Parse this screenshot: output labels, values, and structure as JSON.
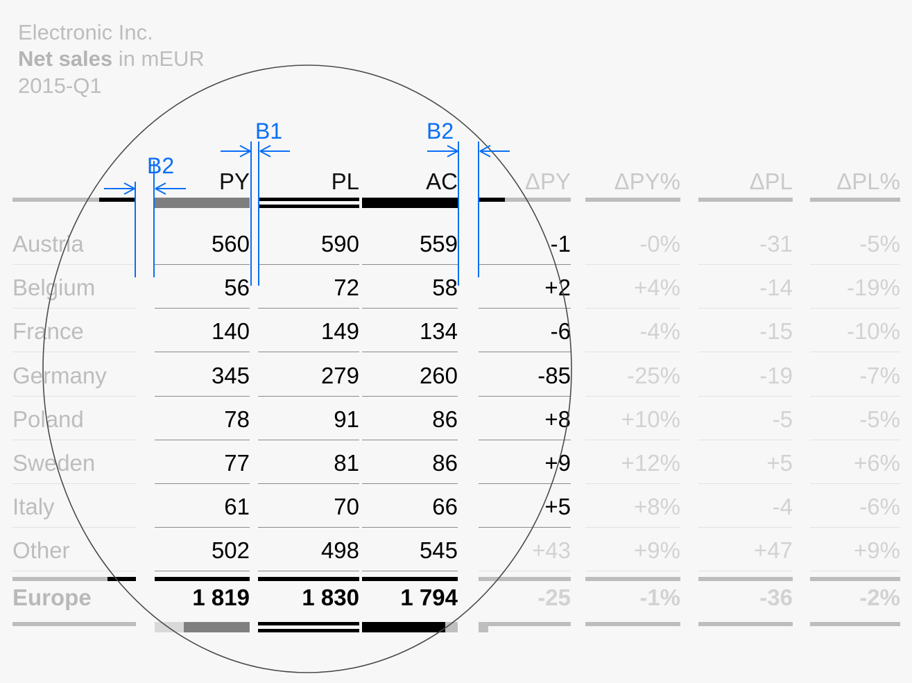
{
  "title": {
    "company": "Electronic Inc.",
    "measure_strong": "Net sales",
    "measure_rest": " in mEUR",
    "period": "2015-Q1"
  },
  "colors": {
    "annotation": "#0a6ef5",
    "previous_year": "#7f7f7f",
    "actual": "#000000",
    "plan": "#000000",
    "dim_text": "#c9c9c9"
  },
  "annotations": [
    {
      "label": "B2",
      "kind": "gap-wide"
    },
    {
      "label": "B1",
      "kind": "gap-narrow"
    },
    {
      "label": "B2",
      "kind": "gap-wide"
    }
  ],
  "table": {
    "headers": [
      "PY",
      "PL",
      "AC",
      "ΔPY",
      "ΔPY%",
      "ΔPL",
      "ΔPL%"
    ],
    "row_label_header": "",
    "rows": [
      {
        "label": "Austria",
        "values": [
          "560",
          "590",
          "559",
          "-1",
          "-0%",
          "-31",
          "-5%"
        ]
      },
      {
        "label": "Belgium",
        "values": [
          "56",
          "72",
          "58",
          "+2",
          "+4%",
          "-14",
          "-19%"
        ]
      },
      {
        "label": "France",
        "values": [
          "140",
          "149",
          "134",
          "-6",
          "-4%",
          "-15",
          "-10%"
        ]
      },
      {
        "label": "Germany",
        "values": [
          "345",
          "279",
          "260",
          "-85",
          "-25%",
          "-19",
          "-7%"
        ]
      },
      {
        "label": "Poland",
        "values": [
          "78",
          "91",
          "86",
          "+8",
          "+10%",
          "-5",
          "-5%"
        ]
      },
      {
        "label": "Sweden",
        "values": [
          "77",
          "81",
          "86",
          "+9",
          "+12%",
          "+5",
          "+6%"
        ]
      },
      {
        "label": "Italy",
        "values": [
          "61",
          "70",
          "66",
          "+5",
          "+8%",
          "-4",
          "-6%"
        ]
      },
      {
        "label": "Other",
        "values": [
          "502",
          "498",
          "545",
          "+43",
          "+9%",
          "+47",
          "+9%"
        ]
      }
    ],
    "total": {
      "label": "Europe",
      "values": [
        "1 819",
        "1 830",
        "1 794",
        "-25",
        "-1%",
        "-36",
        "-2%"
      ]
    }
  },
  "chart_data": {
    "type": "table",
    "title": "Electronic Inc. Net sales in mEUR 2015-Q1",
    "categories": [
      "Austria",
      "Belgium",
      "France",
      "Germany",
      "Poland",
      "Sweden",
      "Italy",
      "Other",
      "Europe"
    ],
    "series": [
      {
        "name": "PY",
        "values": [
          560,
          56,
          140,
          345,
          78,
          77,
          61,
          502,
          1819
        ]
      },
      {
        "name": "PL",
        "values": [
          590,
          72,
          149,
          279,
          91,
          81,
          70,
          498,
          1830
        ]
      },
      {
        "name": "AC",
        "values": [
          559,
          58,
          134,
          260,
          86,
          86,
          66,
          545,
          1794
        ]
      },
      {
        "name": "ΔPY",
        "values": [
          -1,
          2,
          -6,
          -85,
          8,
          9,
          5,
          43,
          -25
        ]
      },
      {
        "name": "ΔPY%",
        "values": [
          0,
          4,
          -4,
          -25,
          10,
          12,
          8,
          9,
          -1
        ]
      },
      {
        "name": "ΔPL",
        "values": [
          -31,
          -14,
          -15,
          -19,
          -5,
          5,
          -4,
          47,
          -36
        ]
      },
      {
        "name": "ΔPL%",
        "values": [
          -5,
          -19,
          -10,
          -7,
          -5,
          6,
          -6,
          9,
          -2
        ]
      }
    ],
    "ylabel": "mEUR",
    "xlabel": "",
    "legend": [
      "PY",
      "PL",
      "AC"
    ]
  }
}
